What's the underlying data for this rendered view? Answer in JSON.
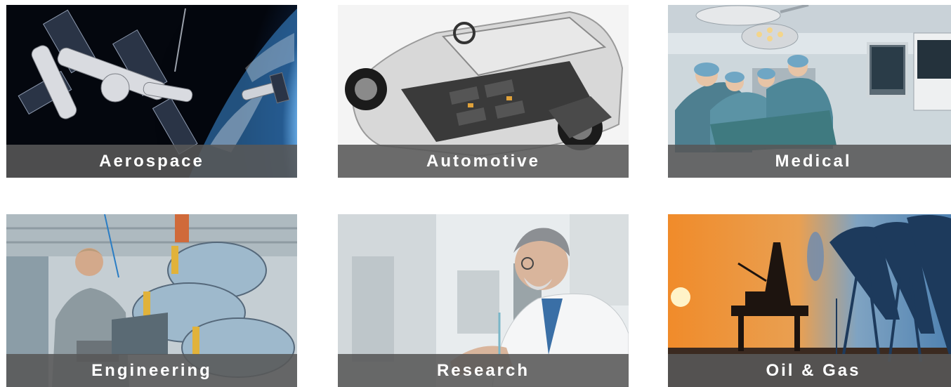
{
  "industries": [
    {
      "label": "Aerospace",
      "photo": "space-station-photo"
    },
    {
      "label": "Automotive",
      "photo": "car-chassis-photo"
    },
    {
      "label": "Medical",
      "photo": "surgery-room-photo"
    },
    {
      "label": "Engineering",
      "photo": "factory-engineer-photo"
    },
    {
      "label": "Research",
      "photo": "lab-scientist-photo"
    },
    {
      "label": "Oil & Gas",
      "photo": "oil-rig-sunset-photo"
    }
  ]
}
